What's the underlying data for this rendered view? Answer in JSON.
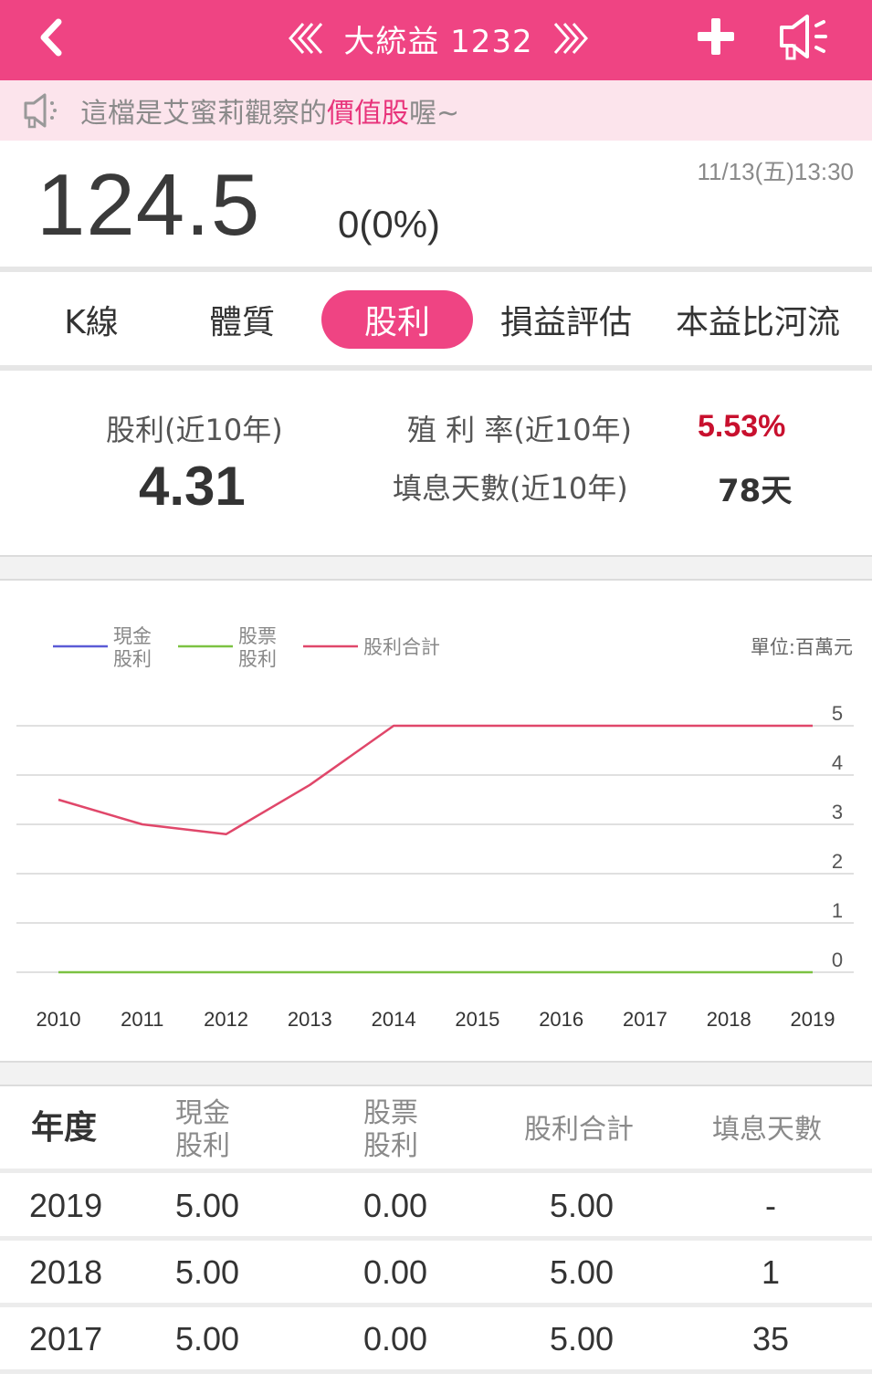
{
  "header": {
    "title": "大統益 1232",
    "back_icon": "chevron-left-icon",
    "prev_icon": "double-chevron-left-icon",
    "next_icon": "double-chevron-right-icon",
    "add_icon": "plus-icon",
    "speaker_icon": "speaker-icon",
    "bg_color": "#ef4483"
  },
  "notice": {
    "prefix": "這檔是艾蜜莉觀察的",
    "highlight": "價值股",
    "suffix": "喔~",
    "icon": "speaker-icon"
  },
  "quote": {
    "price": "124.5",
    "change": "0(0%)",
    "datetime": "11/13(五)13:30"
  },
  "tabs": [
    {
      "label": "K線",
      "active": false
    },
    {
      "label": "體質",
      "active": false
    },
    {
      "label": "股利",
      "active": true
    },
    {
      "label": "損益評估",
      "active": false
    },
    {
      "label": "本益比河流",
      "active": false
    }
  ],
  "summary": {
    "dividend_label": "股利(近10年)",
    "dividend_value": "4.31",
    "yield_label": "殖 利 率(近10年)",
    "yield_value": "5.53%",
    "fill_days_label": "填息天數(近10年)",
    "fill_days_value": "78天"
  },
  "chart_data": {
    "type": "line",
    "unit_label": "單位:百萬元",
    "x": [
      "2010",
      "2011",
      "2012",
      "2013",
      "2014",
      "2015",
      "2016",
      "2017",
      "2018",
      "2019"
    ],
    "ylim": [
      0,
      5
    ],
    "yticks": [
      "0",
      "1",
      "2",
      "3",
      "4",
      "5"
    ],
    "grid": true,
    "legend_position": "top-left",
    "series": [
      {
        "name": "現金股利",
        "legend_lines": [
          "現金",
          "股利"
        ],
        "color": "#5b5bd6",
        "values": null
      },
      {
        "name": "股票股利",
        "legend_lines": [
          "股票",
          "股利"
        ],
        "color": "#7cc242",
        "values": [
          0,
          0,
          0,
          0,
          0,
          0,
          0,
          0,
          0,
          0
        ]
      },
      {
        "name": "股利合計",
        "legend_lines": [
          "股利合計"
        ],
        "color": "#e0476a",
        "values": [
          3.5,
          3.0,
          2.8,
          3.8,
          5.0,
          5.0,
          5.0,
          5.0,
          5.0,
          5.0
        ]
      }
    ]
  },
  "table": {
    "headers": [
      [
        "年度"
      ],
      [
        "現金",
        "股利"
      ],
      [
        "股票",
        "股利"
      ],
      [
        "股利合計"
      ],
      [
        "填息天數"
      ]
    ],
    "rows": [
      [
        "2019",
        "5.00",
        "0.00",
        "5.00",
        "-"
      ],
      [
        "2018",
        "5.00",
        "0.00",
        "5.00",
        "1"
      ],
      [
        "2017",
        "5.00",
        "0.00",
        "5.00",
        "35"
      ]
    ]
  }
}
